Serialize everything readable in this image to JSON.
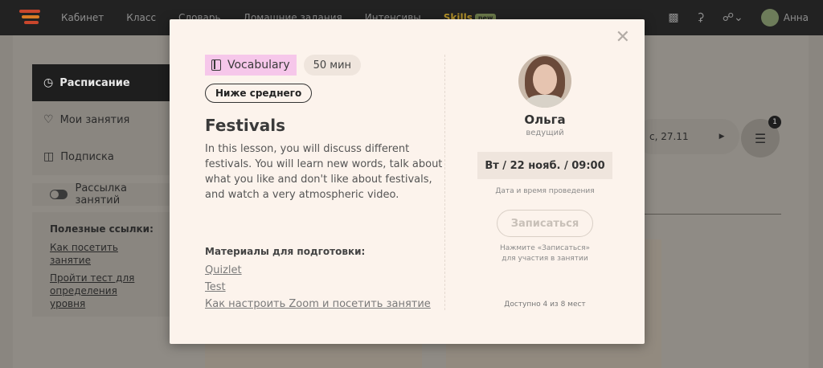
{
  "topbar": {
    "nav": [
      "Кабинет",
      "Класс",
      "Словарь",
      "Домашние задания",
      "Интенсивы"
    ],
    "skills_label": "Skills",
    "skills_badge": "new",
    "user_name": "Анна"
  },
  "sidebar": {
    "items": [
      {
        "label": "Расписание",
        "icon": "clock-icon",
        "active": true
      },
      {
        "label": "Мои занятия",
        "icon": "heart-icon",
        "active": false
      },
      {
        "label": "Подписка",
        "icon": "ticket-icon",
        "active": false
      }
    ],
    "newsletter_label": "Рассылка занятий",
    "links_title": "Полезные ссылки:",
    "links": [
      "Как посетить занятие",
      "Пройти тест для определения уровня"
    ]
  },
  "schedule": {
    "date_label": "с, 27.11",
    "filter_count": "1"
  },
  "modal": {
    "category": "Vocabulary",
    "duration": "50 мин",
    "level": "Ниже среднего",
    "title": "Festivals",
    "description": "In this lesson, you will discuss different festivals. You will learn new words, talk about what you like and don't like about festivals, and watch a very atmospheric video.",
    "materials_title": "Материалы для подготовки:",
    "materials": [
      "Quizlet",
      "Test",
      "Как настроить Zoom и посетить занятие"
    ],
    "teacher_name": "Ольга",
    "teacher_role": "ведущий",
    "datetime": "Вт / 22 нояб. / 09:00",
    "datetime_caption": "Дата и время проведения",
    "signup_label": "Записаться",
    "signup_hint": "Нажмите «Записаться»\nдля участия в занятии",
    "availability": "Доступно 4 из 8 мест",
    "close_icon": "close-icon",
    "category_color": "#f6c7ea"
  }
}
